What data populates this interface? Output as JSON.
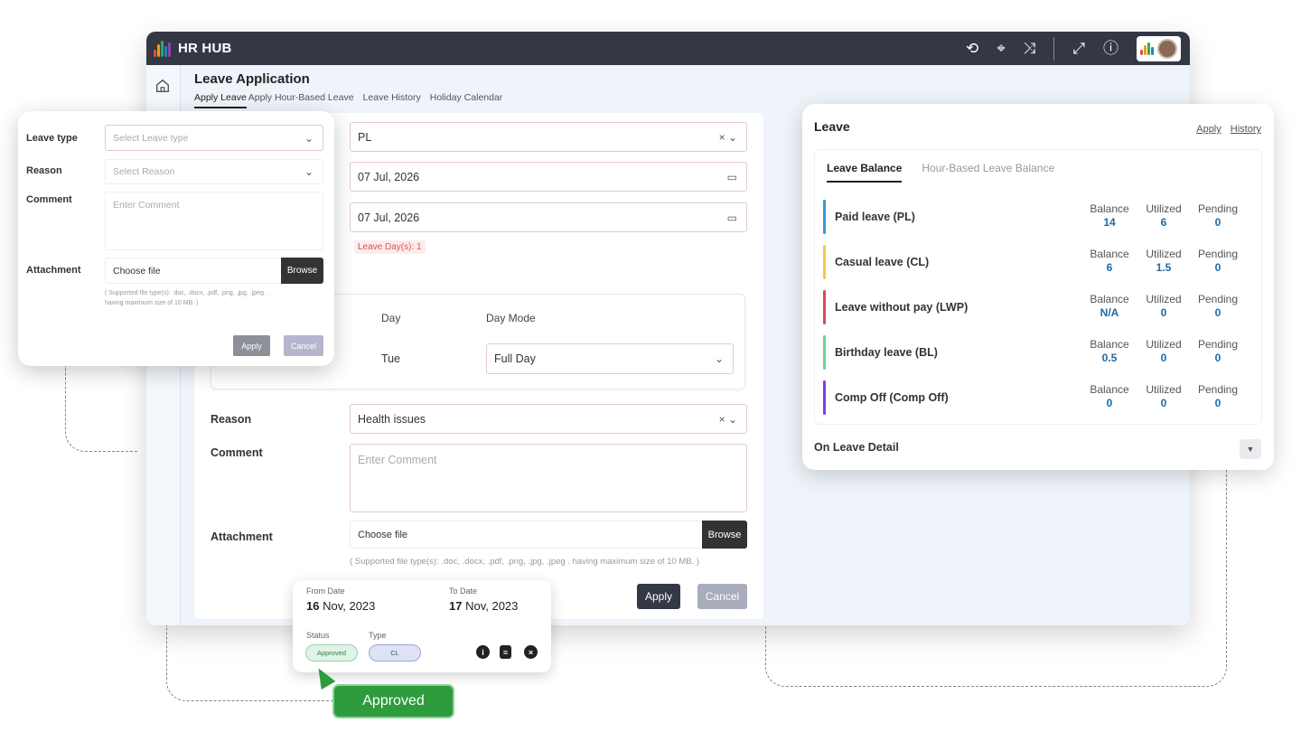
{
  "app": {
    "brand": "HR HUB"
  },
  "page": {
    "title": "Leave Application",
    "tabs": [
      "Apply Leave",
      "Apply Hour-Based Leave",
      "Leave History",
      "Holiday Calendar"
    ]
  },
  "form": {
    "leave_type": "PL",
    "from_date": "07 Jul, 2026",
    "to_date": "07 Jul, 2026",
    "leave_days": "Leave Day(s): 1",
    "table_headers": {
      "day": "Day",
      "day_mode": "Day Mode"
    },
    "row": {
      "day": "Tue",
      "day_mode": "Full Day"
    },
    "reason_label": "Reason",
    "reason_value": "Health issues",
    "comment_label": "Comment",
    "comment_placeholder": "Enter Comment",
    "attachment_label": "Attachment",
    "choose_file": "Choose file",
    "browse": "Browse",
    "hint": "( Supported file type(s): .doc, .docx, .pdf, .png, .jpg, .jpeg . having maximum size of 10 MB. )",
    "apply": "Apply",
    "cancel": "Cancel"
  },
  "mini_form": {
    "leave_type_label": "Leave type",
    "leave_type_placeholder": "Select Leave type",
    "reason_label": "Reason",
    "reason_placeholder": "Select Reason",
    "comment_label": "Comment",
    "comment_placeholder": "Enter Comment",
    "attachment_label": "Attachment",
    "choose_file": "Choose file",
    "browse": "Browse",
    "hint_line1": "( Supported file type(s): .doc, .docx, .pdf, .png, .jpg, .jpeg .",
    "hint_line2": "having maximum size of 10 MB. )",
    "apply": "Apply",
    "cancel": "Cancel"
  },
  "leave_panel": {
    "title": "Leave",
    "links": {
      "apply": "Apply",
      "history": "History"
    },
    "tabs": {
      "balance": "Leave Balance",
      "hour": "Hour-Based Leave Balance"
    },
    "col_headers": {
      "balance": "Balance",
      "utilized": "Utilized",
      "pending": "Pending"
    },
    "rows": [
      {
        "name": "Paid leave (PL)",
        "balance": "14",
        "utilized": "6",
        "pending": "0",
        "color": "#2d9cdb"
      },
      {
        "name": "Casual leave (CL)",
        "balance": "6",
        "utilized": "1.5",
        "pending": "0",
        "color": "#f2c94c"
      },
      {
        "name": "Leave without pay (LWP)",
        "balance": "N/A",
        "utilized": "0",
        "pending": "0",
        "color": "#e0455b"
      },
      {
        "name": "Birthday leave (BL)",
        "balance": "0.5",
        "utilized": "0",
        "pending": "0",
        "color": "#6fcf97"
      },
      {
        "name": "Comp Off (Comp Off)",
        "balance": "0",
        "utilized": "0",
        "pending": "0",
        "color": "#7b3fe4"
      }
    ],
    "on_leave_detail": "On Leave Detail"
  },
  "approved_card": {
    "from_label": "From Date",
    "from_day": "16",
    "from_rest": " Nov, 2023",
    "to_label": "To Date",
    "to_day": "17",
    "to_rest": " Nov, 2023",
    "status_label": "Status",
    "type_label": "Type",
    "status_value": "Approved",
    "type_value": "CL"
  },
  "approved_button": "Approved"
}
